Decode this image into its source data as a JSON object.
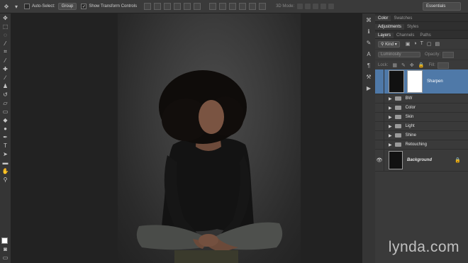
{
  "options_bar": {
    "auto_select_label": "Auto-Select:",
    "auto_select_value": "Group",
    "show_transform_label": "Show Transform Controls",
    "mode_3d_label": "3D Mode:",
    "workspace": "Essentials"
  },
  "panels": {
    "top_tabs": [
      "Color",
      "Swatches"
    ],
    "mid_tabs": [
      "Adjustments",
      "Styles"
    ],
    "layer_tabs": [
      "Layers",
      "Channels",
      "Paths"
    ],
    "kind_label": "Kind",
    "blend_mode": "Luminosity",
    "opacity_label": "Opacity:",
    "lock_label": "Lock:",
    "fill_label": "Fill:"
  },
  "layers": [
    {
      "name": "Sharpen",
      "type": "smart",
      "selected": true,
      "visible": false
    },
    {
      "name": "BW",
      "type": "group",
      "visible": false
    },
    {
      "name": "Color",
      "type": "group",
      "visible": false
    },
    {
      "name": "Skin",
      "type": "group",
      "visible": false
    },
    {
      "name": "Light",
      "type": "group",
      "visible": false
    },
    {
      "name": "Shine",
      "type": "group",
      "visible": false
    },
    {
      "name": "Retouching",
      "type": "group",
      "visible": false
    },
    {
      "name": "Background",
      "type": "background",
      "visible": true,
      "locked": true
    }
  ],
  "watermark": "lynda.com",
  "colors": {
    "selection": "#4f79a8",
    "panel": "#3a3a3a",
    "canvas_bg": "#222222"
  }
}
